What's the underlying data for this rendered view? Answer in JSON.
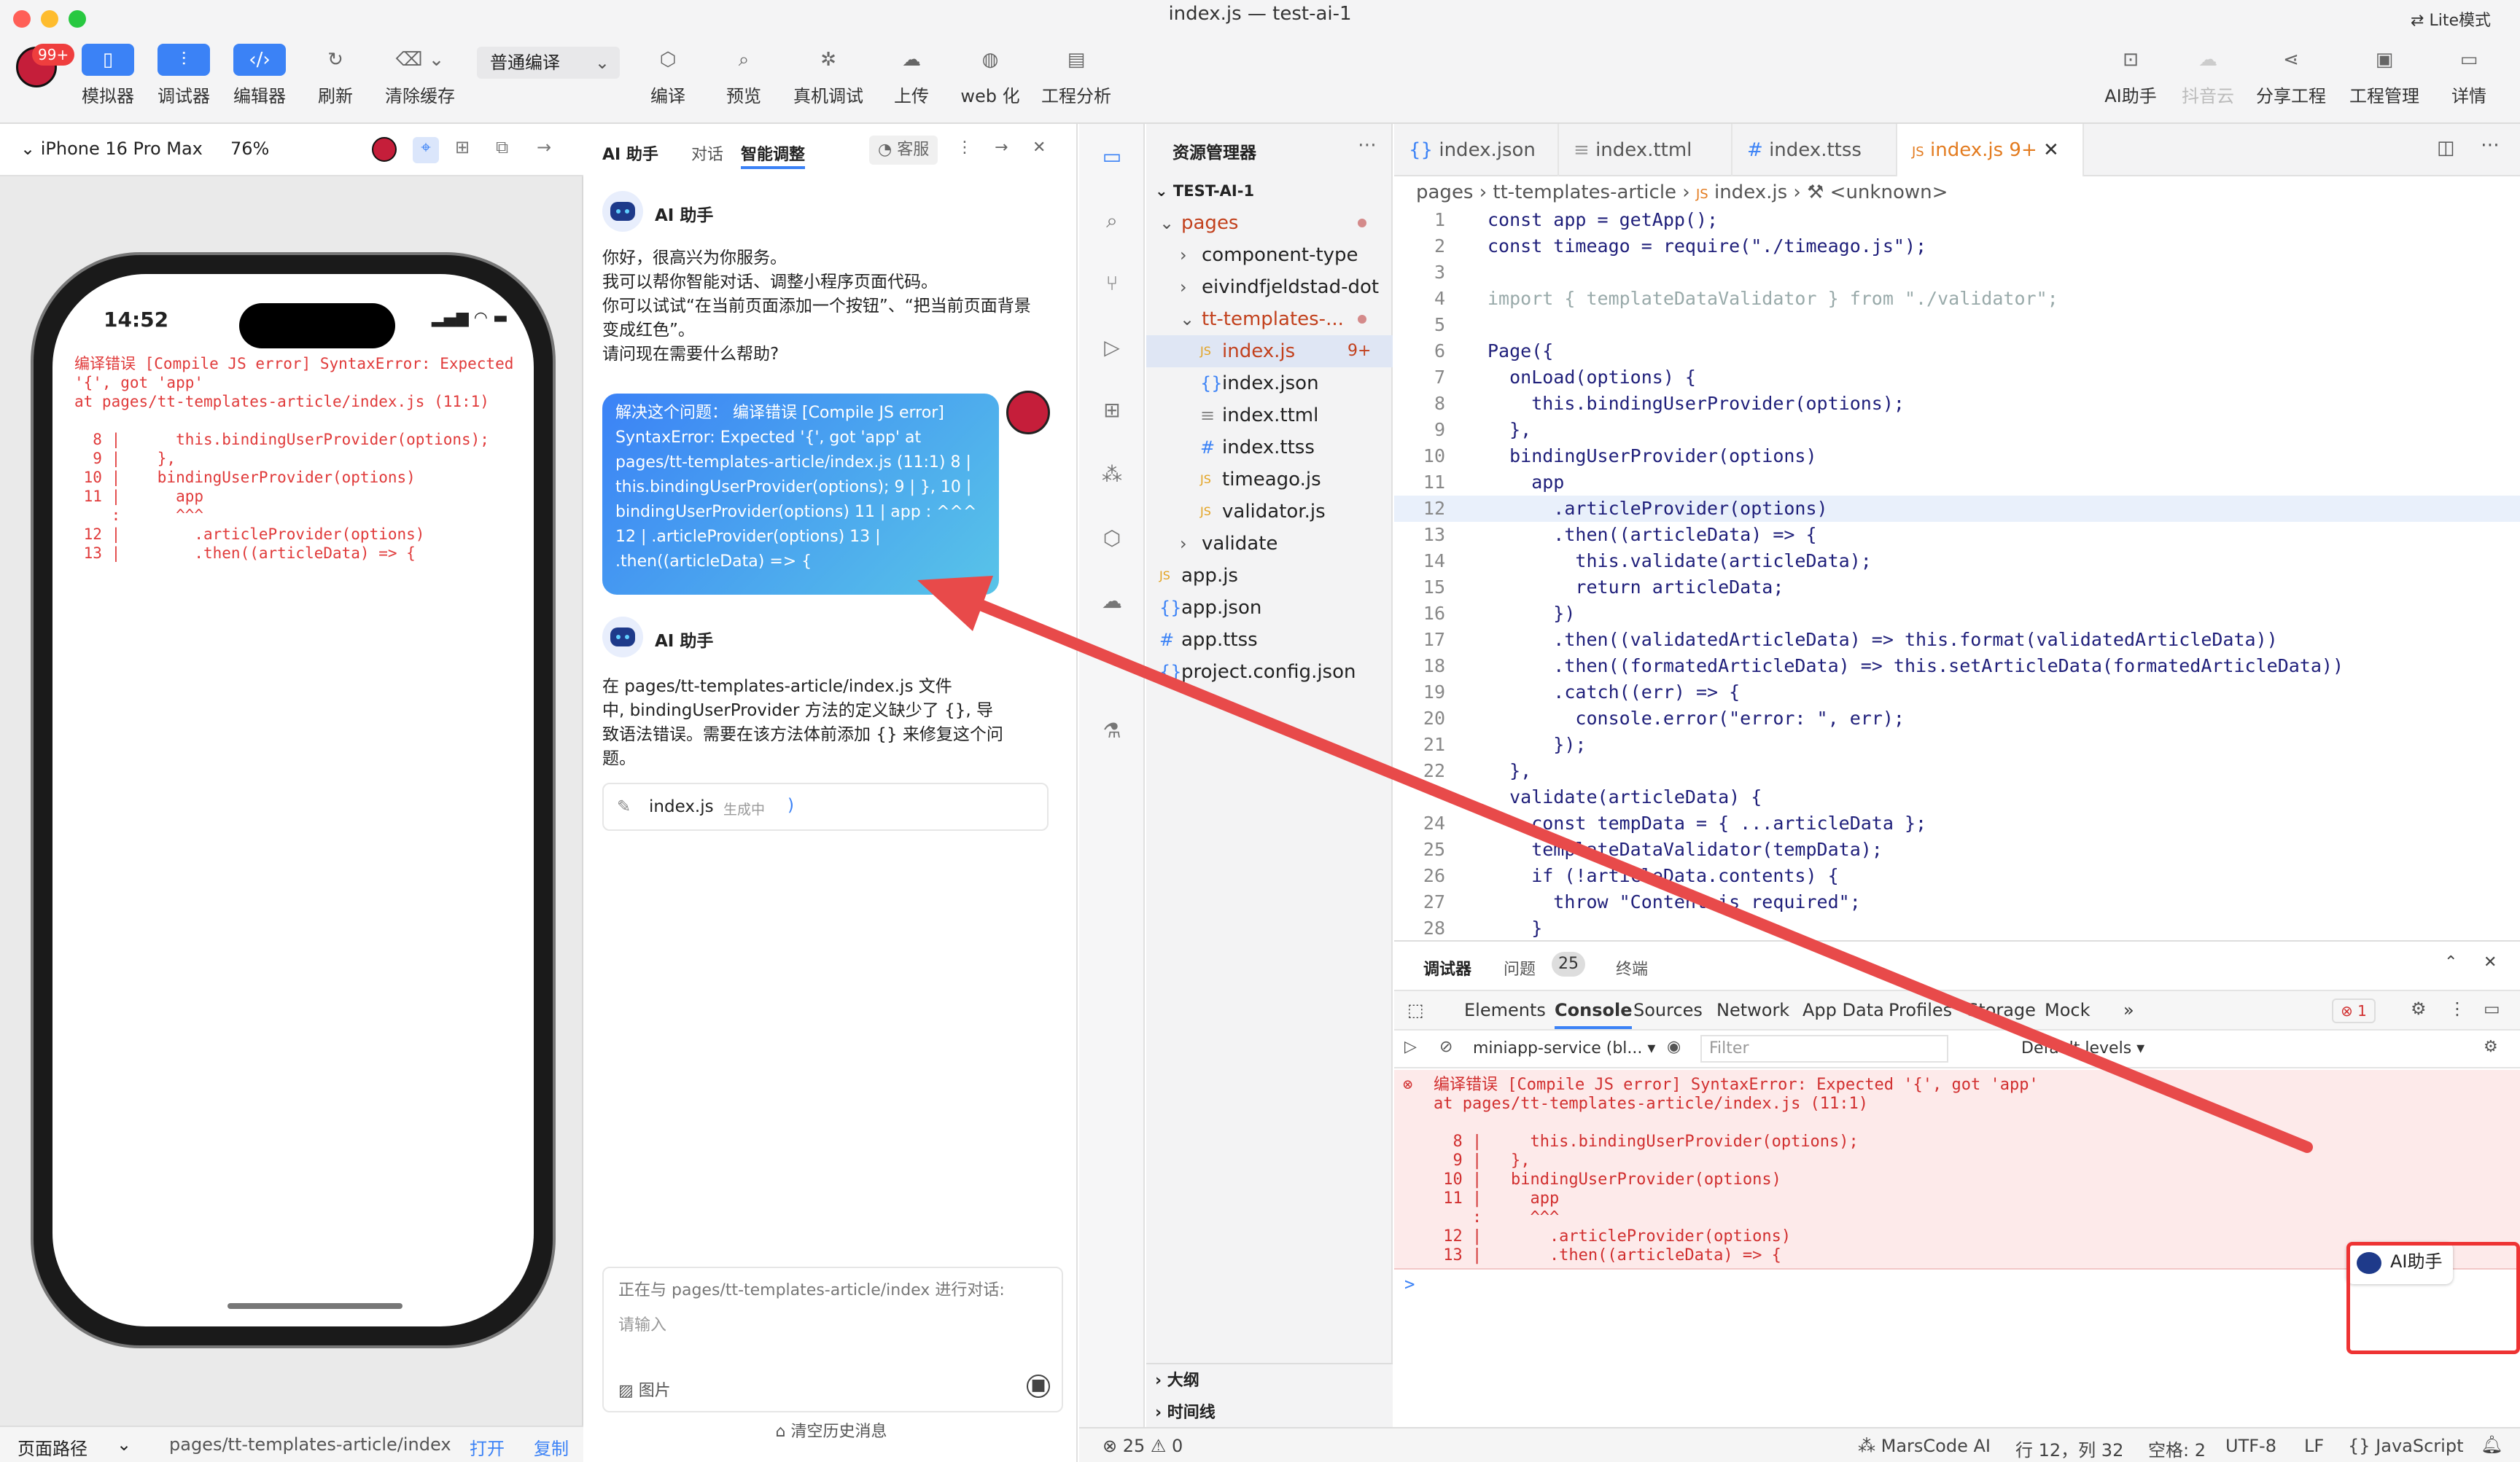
{
  "window": {
    "title": "index.js — test-ai-1",
    "lite_mode": "Lite模式",
    "badge": "99+"
  },
  "toolbar": {
    "left": [
      {
        "label": "模拟器",
        "icon": "phone-icon"
      },
      {
        "label": "调试器",
        "icon": "sliders-icon"
      },
      {
        "label": "编辑器",
        "icon": "code-icon"
      },
      {
        "label": "刷新",
        "icon": "refresh-icon"
      },
      {
        "label": "清除缓存",
        "icon": "clear-cache-icon"
      }
    ],
    "compile_mode": "普通编译",
    "middle": [
      {
        "label": "编译",
        "icon": "cube-icon"
      },
      {
        "label": "预览",
        "icon": "preview-icon"
      },
      {
        "label": "真机调试",
        "icon": "bug-icon"
      },
      {
        "label": "上传",
        "icon": "upload-icon"
      },
      {
        "label": "web 化",
        "icon": "globe-icon"
      },
      {
        "label": "工程分析",
        "icon": "analysis-icon"
      }
    ],
    "right": [
      {
        "label": "AI助手",
        "icon": "robot-icon"
      },
      {
        "label": "抖音云",
        "icon": "cloud-icon"
      },
      {
        "label": "分享工程",
        "icon": "share-icon"
      },
      {
        "label": "工程管理",
        "icon": "manage-icon"
      },
      {
        "label": "详情",
        "icon": "details-icon"
      }
    ]
  },
  "simulator": {
    "device": "iPhone 16 Pro Max",
    "zoom": "76%",
    "time": "14:52",
    "error_text": "编译错误 [Compile JS error] SyntaxError: Expected\n'{', got 'app'\nat pages/tt-templates-article/index.js (11:1)\n\n  8 |      this.bindingUserProvider(options);\n  9 |    },\n 10 |    bindingUserProvider(options)\n 11 |      app\n    :      ^^^\n 12 |        .articleProvider(options)\n 13 |        .then((articleData) => {",
    "footer_label": "页面路径",
    "path": "pages/tt-templates-article/index",
    "open": "打开",
    "copy": "复制"
  },
  "ai_panel": {
    "title": "AI 助手",
    "tab_chat": "对话",
    "tab_smart": "智能调整",
    "service": "客服",
    "assistant_name": "AI 助手",
    "greeting": [
      "你好，很高兴为你服务。",
      "我可以帮你智能对话、调整小程序页面代码。",
      "你可以试试“在当前页面添加一个按钮”、“把当前页面背景",
      "变成红色”。",
      "请问现在需要什么帮助?"
    ],
    "user_message": "解决这个问题： 编译错误 [Compile JS error] SyntaxError: Expected '{', got 'app' at pages/tt-templates-article/index.js (11:1) 8 | this.bindingUserProvider(options); 9 | }, 10 | bindingUserProvider(options) 11 | app : ^^^ 12 | .articleProvider(options) 13 | .then((articleData) => {",
    "reply": [
      "在 pages/tt-templates-article/index.js 文件",
      "中, bindingUserProvider 方法的定义缺少了 {}, 导",
      "致语法错误。需要在该方法体前添加 {} 来修复这个问",
      "题。"
    ],
    "file_card": {
      "name": "index.js",
      "status": "生成中"
    },
    "context": "正在与 pages/tt-templates-article/index 进行对话:",
    "input_placeholder": "请输入",
    "image": "图片",
    "clear_history": "清空历史消息"
  },
  "explorer": {
    "title": "资源管理器",
    "root": "TEST-AI-1",
    "items": [
      {
        "label": "pages",
        "type": "folder-open",
        "indent": 1
      },
      {
        "label": "component-type",
        "type": "folder",
        "indent": 2
      },
      {
        "label": "eivindfjeldstad-dot",
        "type": "folder",
        "indent": 2
      },
      {
        "label": "tt-templates-...",
        "type": "folder-open",
        "indent": 2
      },
      {
        "label": "index.js",
        "type": "js",
        "indent": 3,
        "badge": "9+"
      },
      {
        "label": "index.json",
        "type": "json",
        "indent": 3
      },
      {
        "label": "index.ttml",
        "type": "ttml",
        "indent": 3
      },
      {
        "label": "index.ttss",
        "type": "ttss",
        "indent": 3
      },
      {
        "label": "timeago.js",
        "type": "js",
        "indent": 3
      },
      {
        "label": "validator.js",
        "type": "js",
        "indent": 3
      },
      {
        "label": "validate",
        "type": "folder",
        "indent": 2
      },
      {
        "label": "app.js",
        "type": "js",
        "indent": 1
      },
      {
        "label": "app.json",
        "type": "json",
        "indent": 1
      },
      {
        "label": "app.ttss",
        "type": "ttss",
        "indent": 1
      },
      {
        "label": "project.config.json",
        "type": "json",
        "indent": 1
      }
    ],
    "outline": "大纲",
    "timeline": "时间线"
  },
  "editor": {
    "tabs": [
      {
        "label": "index.json",
        "icon": "{}"
      },
      {
        "label": "index.ttml",
        "icon": "≡"
      },
      {
        "label": "index.ttss",
        "icon": "#"
      },
      {
        "label": "index.js 9+",
        "icon": "JS"
      }
    ],
    "breadcrumb": [
      "pages",
      "tt-templates-article",
      "index.js",
      "<unknown>"
    ],
    "lines": [
      {
        "n": "1",
        "code": "const app = getApp();"
      },
      {
        "n": "2",
        "code": "const timeago = require(\"./timeago.js\");"
      },
      {
        "n": "3",
        "code": ""
      },
      {
        "n": "4",
        "code": "import { templateDataValidator } from \"./validator\";"
      },
      {
        "n": "5",
        "code": ""
      },
      {
        "n": "6",
        "code": "Page({"
      },
      {
        "n": "7",
        "code": "  onLoad(options) {"
      },
      {
        "n": "8",
        "code": "    this.bindingUserProvider(options);"
      },
      {
        "n": "9",
        "code": "  },"
      },
      {
        "n": "10",
        "code": "  bindingUserProvider(options)"
      },
      {
        "n": "11",
        "code": "    app"
      },
      {
        "n": "12",
        "code": "      .articleProvider(options)"
      },
      {
        "n": "13",
        "code": "      .then((articleData) => {"
      },
      {
        "n": "14",
        "code": "        this.validate(articleData);"
      },
      {
        "n": "15",
        "code": "        return articleData;"
      },
      {
        "n": "16",
        "code": "      })"
      },
      {
        "n": "17",
        "code": "      .then((validatedArticleData) => this.format(validatedArticleData))"
      },
      {
        "n": "18",
        "code": "      .then((formatedArticleData) => this.setArticleData(formatedArticleData))"
      },
      {
        "n": "19",
        "code": "      .catch((err) => {"
      },
      {
        "n": "20",
        "code": "        console.error(\"error: \", err);"
      },
      {
        "n": "21",
        "code": "      });"
      },
      {
        "n": "22",
        "code": "  },"
      },
      {
        "n": "",
        "code": "  validate(articleData) {"
      },
      {
        "n": "24",
        "code": "    const tempData = { ...articleData };"
      },
      {
        "n": "25",
        "code": "    templateDataValidator(tempData);"
      },
      {
        "n": "26",
        "code": "    if (!articleData.contents) {"
      },
      {
        "n": "27",
        "code": "      throw \"Content is required\";"
      },
      {
        "n": "28",
        "code": "    }"
      }
    ]
  },
  "bottom_panel": {
    "tabs": [
      "调试器",
      "问题",
      "终端"
    ],
    "problem_count": "25",
    "devtools_tabs": [
      "Elements",
      "Console",
      "Sources",
      "Network",
      "App Data",
      "Profiles",
      "Storage",
      "Mock",
      "»"
    ],
    "error_badge": "1",
    "context_select": "miniapp-service (bl...",
    "filter_placeholder": "Filter",
    "levels": "Default levels",
    "console_error": "编译错误 [Compile JS error] SyntaxError: Expected '{', got 'app'\nat pages/tt-templates-article/index.js (11:1)\n\n  8 |     this.bindingUserProvider(options);\n  9 |   },\n 10 |   bindingUserProvider(options)\n 11 |     app\n    :     ^^^\n 12 |       .articleProvider(options)\n 13 |       .then((articleData) => {",
    "prompt": ">",
    "ai_button": "AI助手"
  },
  "status_bar": {
    "errors": "⊗ 25 ⚠ 0",
    "marscode": "MarsCode AI",
    "position": "行 12，列 32",
    "spaces": "空格: 2",
    "encoding": "UTF-8",
    "eol": "LF",
    "language": "{} JavaScript"
  },
  "colors": {
    "accent": "#3b82f6",
    "error": "#e03a3a",
    "highlight_box": "#e33333"
  }
}
